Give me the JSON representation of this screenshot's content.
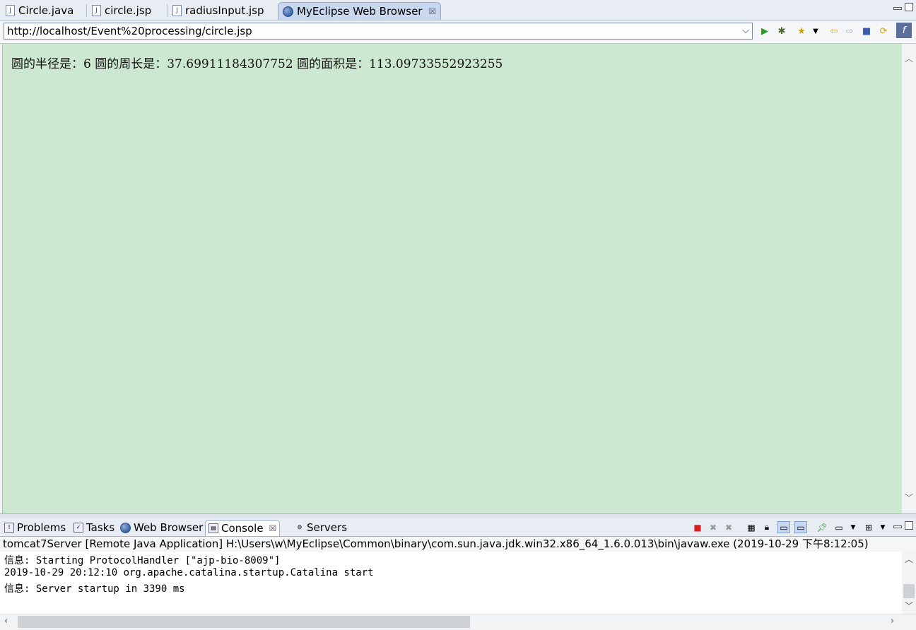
{
  "editor_tabs": [
    {
      "label": "Circle.java",
      "icon": "java-file-icon",
      "active": false
    },
    {
      "label": "circle.jsp",
      "icon": "jsp-file-icon",
      "active": false
    },
    {
      "label": "radiusInput.jsp",
      "icon": "jsp-file-icon",
      "active": false
    },
    {
      "label": "MyEclipse Web Browser",
      "icon": "globe-icon",
      "active": true,
      "close": "☒"
    }
  ],
  "browser": {
    "url": "http://localhost/Event%20processing/circle.jsp",
    "dropdown": "⌵",
    "result_text": "圆的半径是：6 圆的周长是：37.69911184307752 圆的面积是：113.09733552923255"
  },
  "bottom_tabs": [
    {
      "label": "Problems",
      "icon": "problems-icon"
    },
    {
      "label": "Tasks",
      "icon": "tasks-icon"
    },
    {
      "label": "Web Browser",
      "icon": "globe-icon"
    },
    {
      "label": "Console",
      "icon": "console-icon",
      "active": true,
      "close": "☒"
    },
    {
      "label": "Servers",
      "icon": "servers-icon"
    }
  ],
  "console": {
    "header": "tomcat7Server [Remote Java Application] H:\\Users\\w\\MyEclipse\\Common\\binary\\com.sun.java.jdk.win32.x86_64_1.6.0.013\\bin\\javaw.exe (2019-10-29 下午8:12:05)",
    "lines": [
      "信息: Starting ProtocolHandler [\"ajp-bio-8009\"]",
      "2019-10-29 20:12:10 org.apache.catalina.startup.Catalina start",
      "信息: Server startup in 3390 ms"
    ]
  },
  "colors": {
    "content_bg": "#cde8d0",
    "active_tab": "#c9d8ef",
    "stop_red": "#d62020"
  }
}
